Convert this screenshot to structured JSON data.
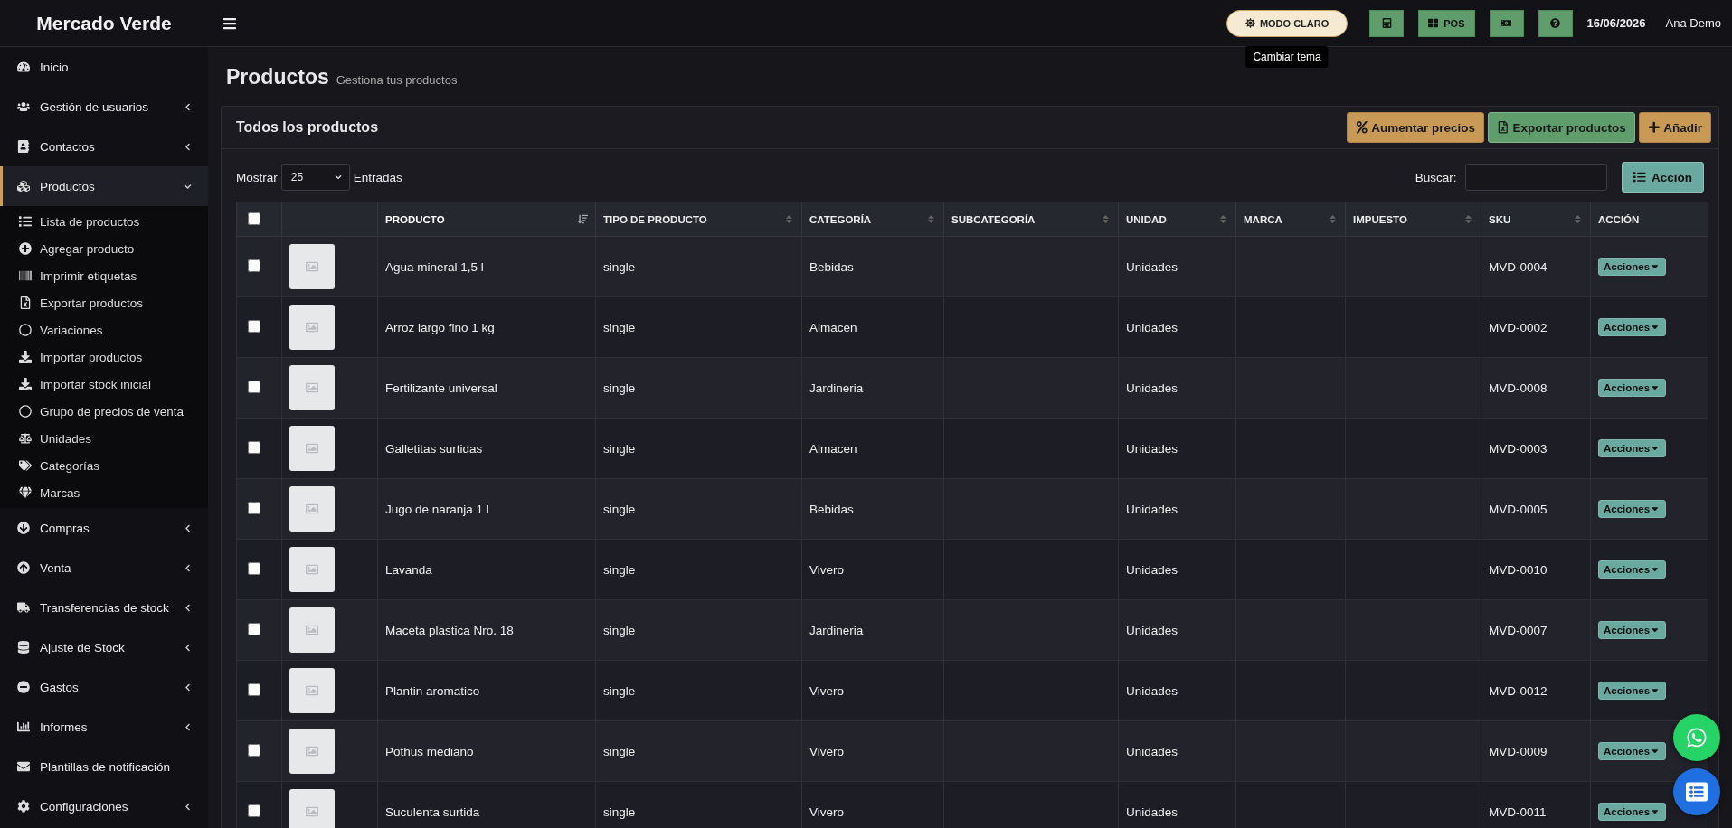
{
  "brand": "Mercado Verde",
  "topbar": {
    "theme_button": "MODO CLARO",
    "tooltip": "Cambiar tema",
    "pos_button": "POS",
    "date": "16/06/2026",
    "user": "Ana Demo"
  },
  "sidebar": {
    "items": [
      {
        "label": "Inicio",
        "kind": "link",
        "selected": false
      },
      {
        "label": "Gestión de usuarios",
        "kind": "menu",
        "selected": false,
        "expanded": false
      },
      {
        "label": "Contactos",
        "kind": "menu",
        "selected": false,
        "expanded": false
      },
      {
        "label": "Productos",
        "kind": "menu",
        "selected": true,
        "expanded": true,
        "children": [
          {
            "label": "Lista de productos"
          },
          {
            "label": "Agregar producto"
          },
          {
            "label": "Imprimir etiquetas"
          },
          {
            "label": "Exportar productos"
          },
          {
            "label": "Variaciones"
          },
          {
            "label": "Importar productos"
          },
          {
            "label": "Importar stock inicial"
          },
          {
            "label": "Grupo de precios de venta"
          },
          {
            "label": "Unidades"
          },
          {
            "label": "Categorías"
          },
          {
            "label": "Marcas"
          }
        ]
      },
      {
        "label": "Compras",
        "kind": "menu",
        "selected": false,
        "expanded": false
      },
      {
        "label": "Venta",
        "kind": "menu",
        "selected": false,
        "expanded": false
      },
      {
        "label": "Transferencias de stock",
        "kind": "menu",
        "selected": false,
        "expanded": false
      },
      {
        "label": "Ajuste de Stock",
        "kind": "menu",
        "selected": false,
        "expanded": false
      },
      {
        "label": "Gastos",
        "kind": "menu",
        "selected": false,
        "expanded": false
      },
      {
        "label": "Informes",
        "kind": "menu",
        "selected": false,
        "expanded": false
      },
      {
        "label": "Plantillas de notificación",
        "kind": "link",
        "selected": false
      },
      {
        "label": "Configuraciones",
        "kind": "menu",
        "selected": false,
        "expanded": false
      }
    ]
  },
  "page": {
    "title": "Productos",
    "subtitle": "Gestiona tus productos"
  },
  "card": {
    "title": "Todos los productos",
    "buttons": [
      {
        "label": "Aumentar precios",
        "kind": "percent"
      },
      {
        "label": "Exportar productos",
        "kind": "export"
      },
      {
        "label": "Añadir",
        "kind": "add"
      }
    ],
    "show_label": "Mostrar",
    "page_size": "25",
    "entries_label": "Entradas",
    "search_label": "Buscar:",
    "action_button": "Acción"
  },
  "table": {
    "select_all_checked": false,
    "columns": [
      {
        "label": "PRODUCTO",
        "sortable": true,
        "sorted": true
      },
      {
        "label": "TIPO DE PRODUCTO",
        "sortable": true,
        "sorted": false
      },
      {
        "label": "CATEGORÍA",
        "sortable": true,
        "sorted": false
      },
      {
        "label": "SUBCATEGORÍA",
        "sortable": true,
        "sorted": false
      },
      {
        "label": "UNIDAD",
        "sortable": true,
        "sorted": false
      },
      {
        "label": "MARCA",
        "sortable": true,
        "sorted": false
      },
      {
        "label": "IMPUESTO",
        "sortable": true,
        "sorted": false
      },
      {
        "label": "SKU",
        "sortable": true,
        "sorted": false
      },
      {
        "label": "ACCIÓN",
        "sortable": false,
        "sorted": false
      }
    ],
    "rows": [
      {
        "checked": false,
        "cells": [
          "Agua mineral 1,5 l",
          "single",
          "Bebidas",
          "",
          "Unidades",
          "",
          "",
          "MVD-0004"
        ],
        "action": "Acciones"
      },
      {
        "checked": false,
        "cells": [
          "Arroz largo fino 1 kg",
          "single",
          "Almacen",
          "",
          "Unidades",
          "",
          "",
          "MVD-0002"
        ],
        "action": "Acciones"
      },
      {
        "checked": false,
        "cells": [
          "Fertilizante universal",
          "single",
          "Jardineria",
          "",
          "Unidades",
          "",
          "",
          "MVD-0008"
        ],
        "action": "Acciones"
      },
      {
        "checked": false,
        "cells": [
          "Galletitas surtidas",
          "single",
          "Almacen",
          "",
          "Unidades",
          "",
          "",
          "MVD-0003"
        ],
        "action": "Acciones"
      },
      {
        "checked": false,
        "cells": [
          "Jugo de naranja 1 l",
          "single",
          "Bebidas",
          "",
          "Unidades",
          "",
          "",
          "MVD-0005"
        ],
        "action": "Acciones"
      },
      {
        "checked": false,
        "cells": [
          "Lavanda",
          "single",
          "Vivero",
          "",
          "Unidades",
          "",
          "",
          "MVD-0010"
        ],
        "action": "Acciones"
      },
      {
        "checked": false,
        "cells": [
          "Maceta plastica Nro. 18",
          "single",
          "Jardineria",
          "",
          "Unidades",
          "",
          "",
          "MVD-0007"
        ],
        "action": "Acciones"
      },
      {
        "checked": false,
        "cells": [
          "Plantin aromatico",
          "single",
          "Vivero",
          "",
          "Unidades",
          "",
          "",
          "MVD-0012"
        ],
        "action": "Acciones"
      },
      {
        "checked": false,
        "cells": [
          "Pothus mediano",
          "single",
          "Vivero",
          "",
          "Unidades",
          "",
          "",
          "MVD-0009"
        ],
        "action": "Acciones"
      },
      {
        "checked": false,
        "cells": [
          "Suculenta surtida",
          "single",
          "Vivero",
          "",
          "Unidades",
          "",
          "",
          "MVD-0011"
        ],
        "action": "Acciones"
      }
    ]
  }
}
